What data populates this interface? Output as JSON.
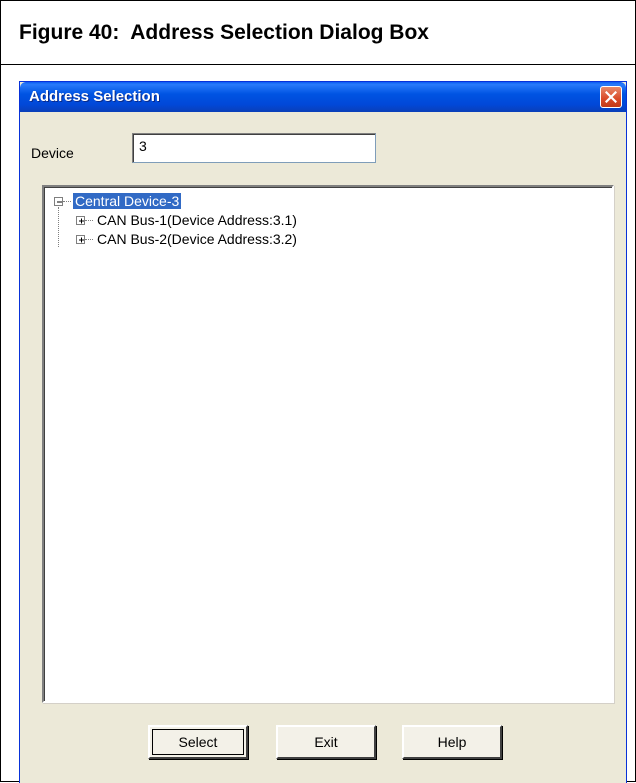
{
  "figure": {
    "title": "Figure 40:  Address Selection Dialog Box"
  },
  "dialog": {
    "title": "Address Selection",
    "device_label": "Device",
    "device_value": "3",
    "tree": {
      "root": {
        "label": "Central Device-3",
        "expanded": true,
        "selected": true,
        "children": [
          {
            "label": "CAN Bus-1(Device Address:3.1)",
            "expanded": false
          },
          {
            "label": "CAN Bus-2(Device Address:3.2)",
            "expanded": false
          }
        ]
      }
    },
    "buttons": {
      "select": "Select",
      "exit": "Exit",
      "help": "Help"
    }
  },
  "colors": {
    "titlebar": "#0054e3",
    "dialog_bg": "#ece9d8",
    "selection": "#316ac5",
    "close_button": "#d94a28"
  },
  "icons": [
    "close-icon",
    "collapse-icon",
    "expand-icon"
  ]
}
